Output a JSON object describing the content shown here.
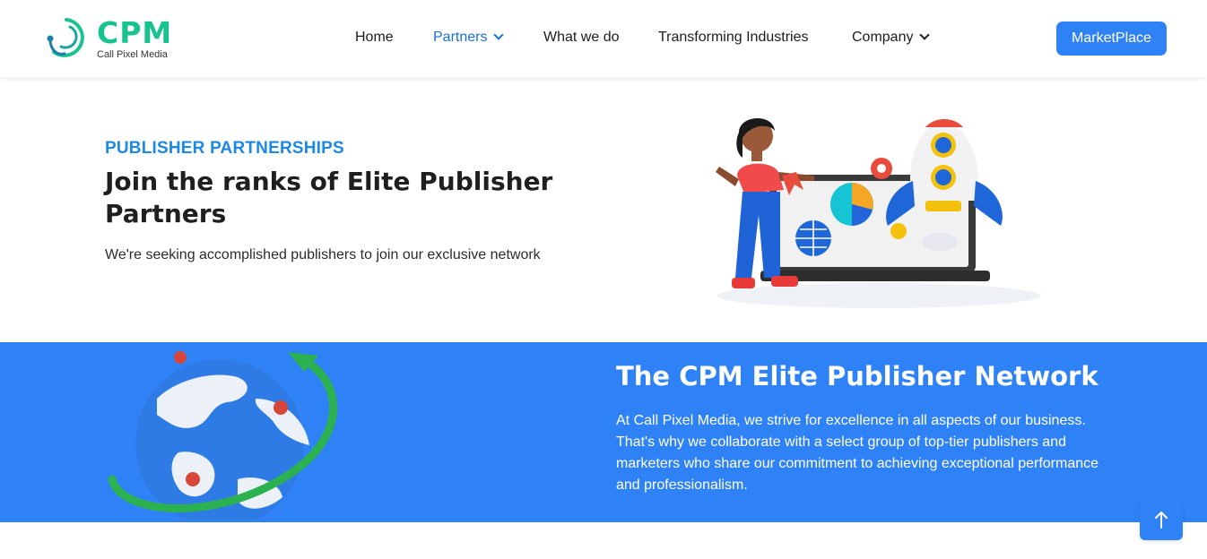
{
  "brand": {
    "name": "CPM",
    "tagline": "Call Pixel Media"
  },
  "nav": {
    "items": [
      {
        "label": "Home"
      },
      {
        "label": "Partners"
      },
      {
        "label": "What we do"
      },
      {
        "label": "Transforming Industries"
      },
      {
        "label": "Company"
      }
    ],
    "cta_label": "MarketPlace"
  },
  "hero": {
    "eyebrow": "PUBLISHER PARTNERSHIPS",
    "title": "Join the ranks of Elite Publisher Partners",
    "text": "We're seeking accomplished publishers to join our exclusive network",
    "illustration": "woman-laptop-rocket-illustration"
  },
  "network": {
    "title": "The CPM Elite Publisher Network",
    "text": "At Call Pixel Media, we strive for excellence in all aspects of our business. That's why we collaborate with a select group of top-tier publishers and marketers who share our commitment to achieving exceptional performance and professionalism.",
    "illustration": "globe-orbit-illustration"
  },
  "scroll_top": {
    "icon": "arrow-up-icon"
  },
  "colors": {
    "brand_green": "#19c38f",
    "accent_blue": "#2f82f5",
    "eyebrow_blue": "#1e88e5",
    "active_nav": "#1a6fd9"
  }
}
